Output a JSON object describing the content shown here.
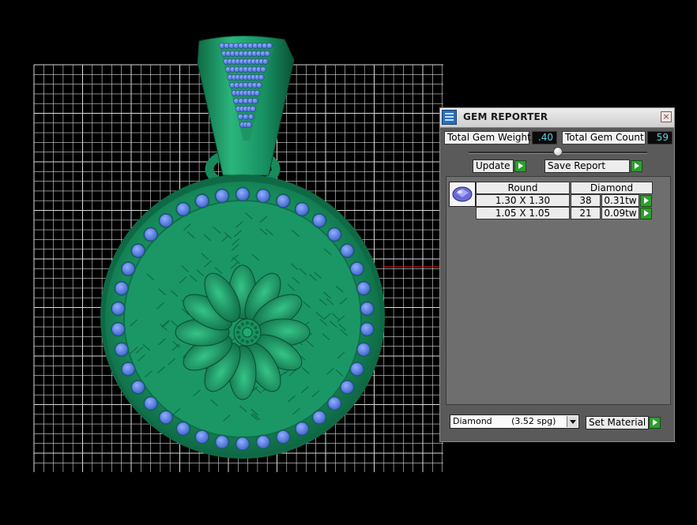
{
  "panel": {
    "title": "GEM REPORTER",
    "close_label": "×",
    "total_weight_label": "Total Gem Weight",
    "total_weight_value": ".40",
    "total_count_label": "Total Gem Count",
    "total_count_value": "59",
    "update_label": "Update",
    "save_report_label": "Save Report",
    "table": {
      "col_shape": "Round",
      "col_material": "Diamond",
      "rows": [
        {
          "size": "1.30 X 1.30",
          "count": "38",
          "weight": "0.31tw"
        },
        {
          "size": "1.05 X 1.05",
          "count": "21",
          "weight": "0.09tw"
        }
      ]
    },
    "material_select": "Diamond       (3.52 spg)",
    "set_material_label": "Set Material"
  },
  "colors": {
    "metal": "#1f9e6b",
    "gem": "#5b7fe0",
    "grid": "#ffffff",
    "panel_bg": "#5a5a5a",
    "value_text": "#5fd0e8",
    "play_button": "#2e9e2e"
  }
}
